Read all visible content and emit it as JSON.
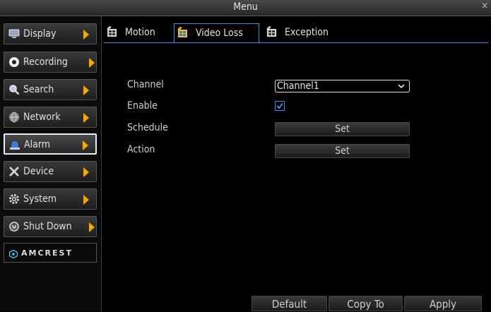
{
  "window": {
    "title": "Menu",
    "close_glyph": "×"
  },
  "sidebar": {
    "items": [
      {
        "label": "Display",
        "icon": "display-icon",
        "arrow": true
      },
      {
        "label": "Recording",
        "icon": "recording-icon",
        "arrow": true
      },
      {
        "label": "Search",
        "icon": "search-icon",
        "arrow": true
      },
      {
        "label": "Network",
        "icon": "network-icon",
        "arrow": true
      },
      {
        "label": "Alarm",
        "icon": "alarm-icon",
        "arrow": true,
        "active": true
      },
      {
        "label": "Device",
        "icon": "device-icon",
        "arrow": true
      },
      {
        "label": "System",
        "icon": "system-icon",
        "arrow": true
      },
      {
        "label": "Shut Down",
        "icon": "shutdown-icon",
        "arrow": true
      }
    ],
    "logo": "AMCREST"
  },
  "tabs": [
    {
      "label": "Motion",
      "icon": "film-icon"
    },
    {
      "label": "Video Loss",
      "icon": "film-icon",
      "active": true
    },
    {
      "label": "Exception",
      "icon": "film-icon"
    }
  ],
  "form": {
    "channel_label": "Channel",
    "channel_value": "Channel1",
    "enable_label": "Enable",
    "enable_checked": true,
    "schedule_label": "Schedule",
    "schedule_button": "Set",
    "action_label": "Action",
    "action_button": "Set"
  },
  "footer": {
    "default_label": "Default",
    "copyto_label": "Copy To",
    "apply_label": "Apply"
  },
  "colors": {
    "accent_blue": "#3b8fe0",
    "arrow_orange": "#f6a800",
    "background": "#000000"
  }
}
